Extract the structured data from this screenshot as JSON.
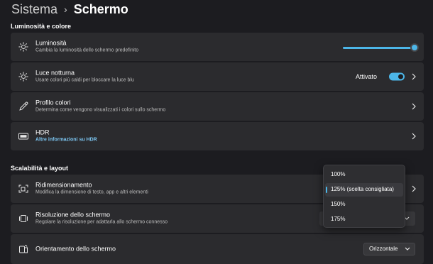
{
  "breadcrumb": {
    "parent": "Sistema",
    "separator": "›",
    "current": "Schermo"
  },
  "sections": {
    "brightness_color": "Luminosità e colore",
    "scale_layout": "Scalabilità e layout"
  },
  "cards": {
    "brightness": {
      "title": "Luminosità",
      "subtitle": "Cambia la luminosità dello schermo predefinito",
      "icon": "sun-icon",
      "level": 0.96
    },
    "night_light": {
      "title": "Luce notturna",
      "subtitle": "Usare colori più caldi per bloccare la luce blu",
      "icon": "sun-icon",
      "status": "Attivato",
      "enabled": true
    },
    "color_profile": {
      "title": "Profilo colori",
      "subtitle": "Determina come vengono visualizzati i colori sullo schermo",
      "icon": "eyedropper-icon"
    },
    "hdr": {
      "title": "HDR",
      "link": "Altre informazioni su HDR",
      "icon": "hdr-icon"
    },
    "scale": {
      "title": "Ridimensionamento",
      "subtitle": "Modifica la dimensione di testo, app e altri elementi",
      "icon": "scale-icon"
    },
    "resolution": {
      "title": "Risoluzione dello schermo",
      "subtitle": "Regolare la risoluzione per adattarla allo schermo connesso",
      "icon": "resolution-icon"
    },
    "orientation": {
      "title": "Orientamento dello schermo",
      "value": "Orizzontale",
      "icon": "orientation-icon"
    }
  },
  "scale_dropdown": {
    "options": [
      "100%",
      "125% (scelta consigliata)",
      "150%",
      "175%"
    ],
    "selected_index": 1
  },
  "colors": {
    "accent": "#4cb6e8",
    "background": "#1c1c20",
    "card": "#2b2b2e"
  }
}
